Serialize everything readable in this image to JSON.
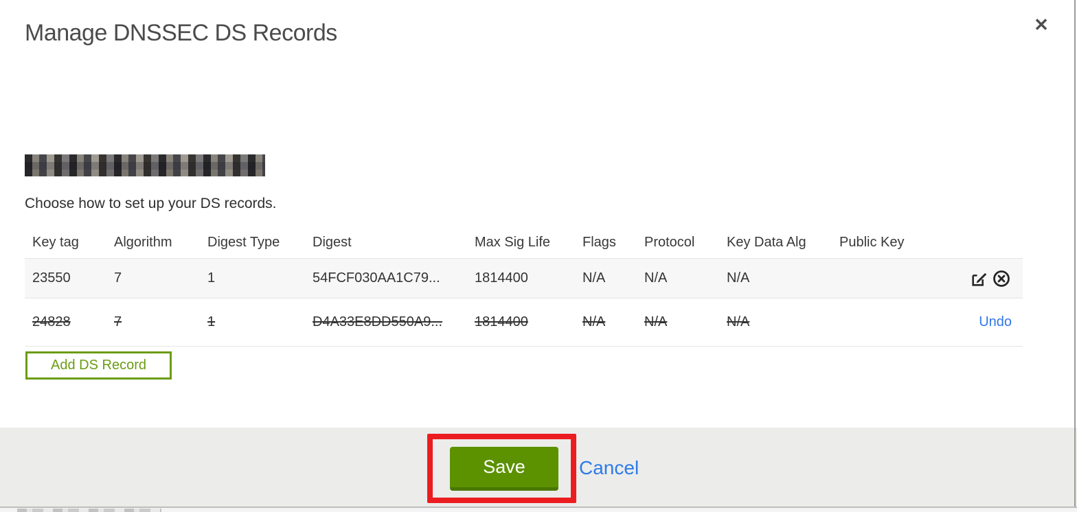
{
  "modal": {
    "title": "Manage DNSSEC DS Records",
    "close_icon": "✕",
    "domain": {
      "redacted": true,
      "note": "domain name is pixelated/blurred out"
    },
    "subtitle": "Choose how to set up your DS records.",
    "table": {
      "headers": [
        "Key tag",
        "Algorithm",
        "Digest Type",
        "Digest",
        "Max Sig Life",
        "Flags",
        "Protocol",
        "Key Data Alg",
        "Public Key"
      ],
      "rows": [
        {
          "cells": [
            "23550",
            "7",
            "1",
            "54FCF030AA1C79...",
            "1814400",
            "N/A",
            "N/A",
            "N/A",
            ""
          ],
          "state": "normal",
          "actions": [
            "edit",
            "delete"
          ]
        },
        {
          "cells": [
            "24828",
            "7",
            "1",
            "D4A33E8DD550A9...",
            "1814400",
            "N/A",
            "N/A",
            "N/A",
            ""
          ],
          "state": "deleted",
          "undo_label": "Undo"
        }
      ]
    },
    "add_button_label": "Add DS Record",
    "footer": {
      "save_label": "Save",
      "cancel_label": "Cancel"
    }
  },
  "annotation": {
    "type": "red-highlight-box",
    "target": "save-button",
    "color": "#ec1d20"
  },
  "colors": {
    "save_green": "#5c9100",
    "save_green_dark": "#4a7700",
    "outline_green": "#6a9c12",
    "link_blue": "#2c7be8",
    "row_gray": "#f7f7f7",
    "footer_gray": "#ececeb"
  }
}
